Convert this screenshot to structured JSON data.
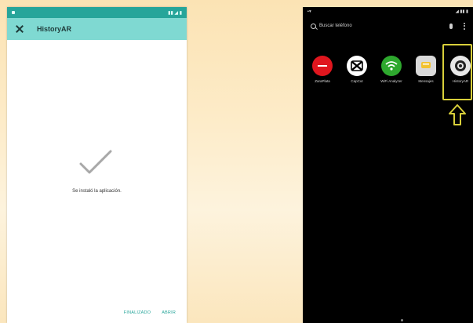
{
  "left_screen": {
    "title": "HistoryAR",
    "message": "Se instaló la aplicación.",
    "actions": [
      "FINALIZADO",
      "ABRIR"
    ],
    "colors": {
      "status_bar": "#26a59a",
      "toolbar": "#7fd9d2",
      "accent": "#26a59a"
    }
  },
  "right_screen": {
    "search_placeholder": "Buscar teléfono",
    "apps": [
      {
        "label": "ZaraPlata",
        "icon": "red-circle-app-icon",
        "color": "#e0161e"
      },
      {
        "label": "CapCut",
        "icon": "capcut-icon",
        "color": "#ffffff"
      },
      {
        "label": "WiFi Analyzer",
        "icon": "wifi-icon",
        "color": "#2ea82e"
      },
      {
        "label": "Mensajes",
        "icon": "messages-icon",
        "color": "#d9d9d9"
      },
      {
        "label": "HistoryAR",
        "icon": "historyar-icon",
        "color": "#e6e6e6"
      }
    ],
    "highlight_color": "#d8cf3a"
  }
}
